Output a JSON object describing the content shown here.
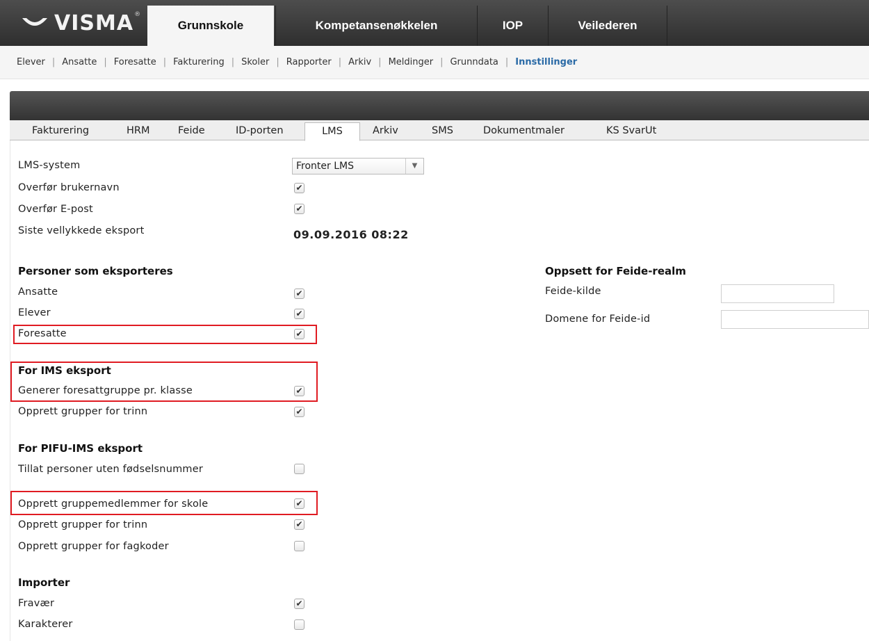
{
  "logo": {
    "text": "VISMA",
    "reg": "®"
  },
  "main_tabs": [
    "Grunnskole",
    "Kompetansenøkkelen",
    "IOP",
    "Veilederen"
  ],
  "subnav": [
    "Elever",
    "Ansatte",
    "Foresatte",
    "Fakturering",
    "Skoler",
    "Rapporter",
    "Arkiv",
    "Meldinger",
    "Grunndata",
    "Innstillinger"
  ],
  "settings_tabs": [
    "Fakturering",
    "HRM",
    "Feide",
    "ID-porten",
    "LMS",
    "Arkiv",
    "SMS",
    "Dokumentmaler",
    "KS SvarUt"
  ],
  "general": {
    "lms_system_label": "LMS-system",
    "lms_system_value": "Fronter LMS",
    "overfor_brukernavn": {
      "label": "Overfør brukernavn",
      "checked": true
    },
    "overfor_epost": {
      "label": "Overfør E-post",
      "checked": true
    },
    "siste_label": "Siste vellykkede eksport",
    "siste_value": "09.09.2016 08:22"
  },
  "personer": {
    "heading": "Personer som eksporteres",
    "ansatte": {
      "label": "Ansatte",
      "checked": true
    },
    "elever": {
      "label": "Elever",
      "checked": true
    },
    "foresatte": {
      "label": "Foresatte",
      "checked": true
    }
  },
  "ims": {
    "heading": "For IMS eksport",
    "generer": {
      "label": "Generer foresattgruppe pr. klasse",
      "checked": true
    },
    "trinn": {
      "label": "Opprett grupper for trinn",
      "checked": true
    }
  },
  "pifu": {
    "heading": "For PIFU-IMS eksport",
    "tillat": {
      "label": "Tillat personer uten fødselsnummer",
      "checked": false
    },
    "medlemmer": {
      "label": "Opprett gruppemedlemmer for skole",
      "checked": true
    },
    "trinn": {
      "label": "Opprett grupper for trinn",
      "checked": true
    },
    "fagkoder": {
      "label": "Opprett grupper for fagkoder",
      "checked": false
    }
  },
  "importer": {
    "heading": "Importer",
    "fravaer": {
      "label": "Fravær",
      "checked": true
    },
    "karakterer": {
      "label": "Karakterer",
      "checked": false
    }
  },
  "feide": {
    "heading": "Oppsett for Feide-realm",
    "kilde_label": "Feide-kilde",
    "kilde_value": "",
    "domene_label": "Domene for Feide-id",
    "domene_value": ""
  },
  "colors": {
    "highlight": "#e01b22",
    "active_link": "#2a6aa6"
  }
}
